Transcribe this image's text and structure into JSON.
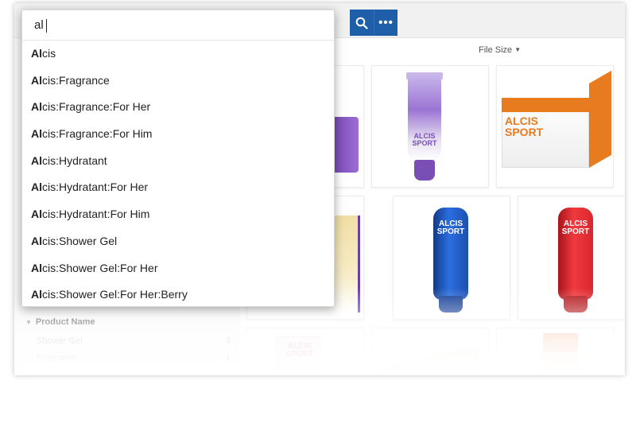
{
  "search": {
    "query": "al",
    "suggestions": [
      {
        "match": "Al",
        "rest": "cis"
      },
      {
        "match": "Al",
        "rest": "cis:Fragrance"
      },
      {
        "match": "Al",
        "rest": "cis:Fragrance:For Her"
      },
      {
        "match": "Al",
        "rest": "cis:Fragrance:For Him"
      },
      {
        "match": "Al",
        "rest": "cis:Hydratant"
      },
      {
        "match": "Al",
        "rest": "cis:Hydratant:For Her"
      },
      {
        "match": "Al",
        "rest": "cis:Hydratant:For Him"
      },
      {
        "match": "Al",
        "rest": "cis:Shower Gel"
      },
      {
        "match": "Al",
        "rest": "cis:Shower Gel:For Her"
      },
      {
        "match": "Al",
        "rest": "cis:Shower Gel:For Her:Berry"
      }
    ]
  },
  "toolbar": {
    "search_icon": "search-icon",
    "more_icon": "more-icon",
    "more_label": "•••",
    "accent": "#1f5fa9"
  },
  "sort": {
    "label": "File Size",
    "icon": "caret-down-icon"
  },
  "facets": {
    "title": "Product Name",
    "items": [
      {
        "label": "Shower Gel",
        "count": "3"
      },
      {
        "label": "Fragrance",
        "count": "1"
      }
    ]
  },
  "products": [
    {
      "brand": "ALCIS\nSPORT",
      "kind": "tube",
      "color": "#7a4fb5"
    },
    {
      "brand": "ALCIS\nSPORT",
      "kind": "box",
      "color": "#e87a1f"
    },
    {
      "brand": "ALCIS\nSPORT",
      "kind": "bottle",
      "color": "#1d4fb0"
    },
    {
      "brand": "ALCIS\nSPORT",
      "kind": "bottle",
      "color": "#d9262c"
    },
    {
      "brand": "ALCIS\nSPORT",
      "kind": "box",
      "color": "#e06b8a"
    }
  ]
}
